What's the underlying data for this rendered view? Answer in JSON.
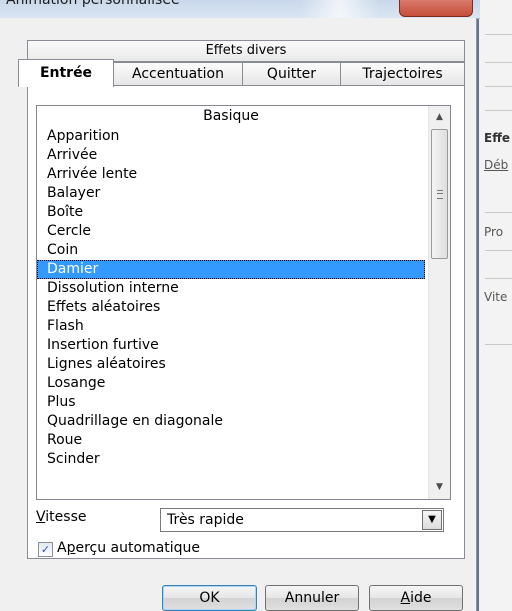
{
  "window": {
    "title": "Animation personnalisée"
  },
  "tabs": {
    "group_label": "Effets divers",
    "items": [
      "Entrée",
      "Accentuation",
      "Quitter",
      "Trajectoires"
    ],
    "active": "Entrée"
  },
  "effects_list": {
    "category_header": "Basique",
    "items": [
      "Apparition",
      "Arrivée",
      "Arrivée lente",
      "Balayer",
      "Boîte",
      "Cercle",
      "Coin",
      "Damier",
      "Dissolution interne",
      "Effets aléatoires",
      "Flash",
      "Insertion furtive",
      "Lignes aléatoires",
      "Losange",
      "Plus",
      "Quadrillage en diagonale",
      "Roue",
      "Scinder"
    ],
    "selected": "Damier"
  },
  "speed": {
    "label_first": "V",
    "label_rest": "itesse",
    "value": "Très rapide"
  },
  "preview": {
    "label_first": "A",
    "label_ul": "p",
    "label_rest": "erçu automatique",
    "checked": true,
    "check_glyph": "✓"
  },
  "buttons": {
    "ok": "OK",
    "cancel": "Annuler",
    "help_first": "A",
    "help_rest": "ide"
  },
  "background_window": {
    "labels": [
      "Effe",
      "Déb",
      "Pro",
      "Vite"
    ]
  },
  "scrollbar": {
    "up_glyph": "▲",
    "down_glyph": "▼",
    "dropdown_glyph": "▼"
  },
  "colors": {
    "selection": "#3399ff",
    "window_frame": "#5f7592",
    "dialog_bg": "#f0f0f0"
  }
}
